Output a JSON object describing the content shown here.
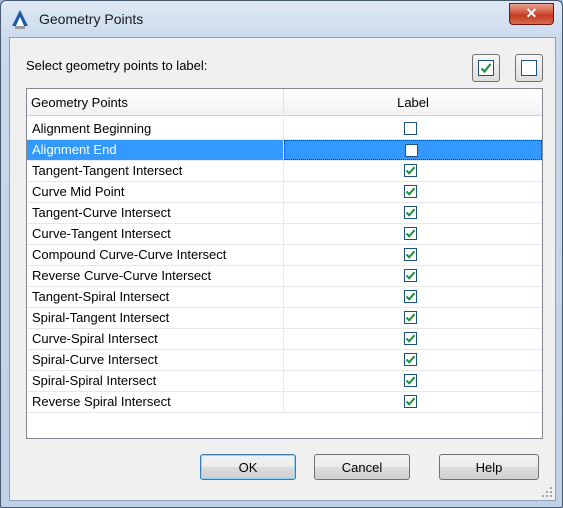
{
  "window": {
    "title": "Geometry Points",
    "close_glyph": "✕"
  },
  "prompt": "Select geometry points to label:",
  "toolbar": {
    "check_all_icon": "check-all-icon",
    "uncheck_all_icon": "uncheck-all-icon"
  },
  "grid": {
    "columns": [
      "Geometry Points",
      "Label"
    ],
    "rows": [
      {
        "name": "Alignment Beginning",
        "checked": false
      },
      {
        "name": "Alignment End",
        "checked": false,
        "selected": true
      },
      {
        "name": "Tangent-Tangent Intersect",
        "checked": true
      },
      {
        "name": "Curve Mid Point",
        "checked": true
      },
      {
        "name": "Tangent-Curve Intersect",
        "checked": true
      },
      {
        "name": "Curve-Tangent Intersect",
        "checked": true
      },
      {
        "name": "Compound Curve-Curve Intersect",
        "checked": true
      },
      {
        "name": "Reverse Curve-Curve Intersect",
        "checked": true
      },
      {
        "name": "Tangent-Spiral Intersect",
        "checked": true
      },
      {
        "name": "Spiral-Tangent Intersect",
        "checked": true
      },
      {
        "name": "Curve-Spiral Intersect",
        "checked": true
      },
      {
        "name": "Spiral-Curve Intersect",
        "checked": true
      },
      {
        "name": "Spiral-Spiral Intersect",
        "checked": true
      },
      {
        "name": "Reverse Spiral Intersect",
        "checked": true
      }
    ]
  },
  "buttons": {
    "ok": "OK",
    "cancel": "Cancel",
    "help": "Help"
  },
  "colors": {
    "selection": "#3399ff",
    "check": "#1e8f3a"
  }
}
